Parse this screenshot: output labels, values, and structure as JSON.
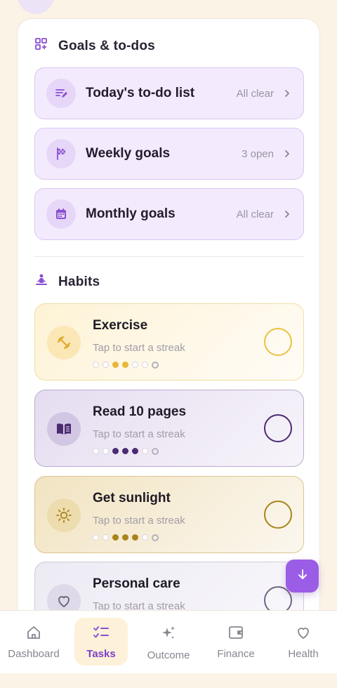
{
  "goals_section": {
    "title": "Goals & to-dos",
    "icon": "grid-plus-icon",
    "items": [
      {
        "label": "Today's to-do list",
        "status": "All clear",
        "icon": "list-edit-icon"
      },
      {
        "label": "Weekly goals",
        "status": "3 open",
        "icon": "flag-checkered-icon"
      },
      {
        "label": "Monthly goals",
        "status": "All clear",
        "icon": "calendar-icon"
      }
    ]
  },
  "habits_section": {
    "title": "Habits",
    "icon": "meditation-icon",
    "items": [
      {
        "title": "Exercise",
        "subtitle": "Tap to start a streak",
        "icon": "dumbbell-icon",
        "color": "#E8B73A",
        "streak_filled": [
          2,
          3
        ]
      },
      {
        "title": "Read 10 pages",
        "subtitle": "Tap to start a streak",
        "icon": "book-open-icon",
        "color": "#4B2A72",
        "streak_filled": [
          2,
          3,
          4
        ]
      },
      {
        "title": "Get sunlight",
        "subtitle": "Tap to start a streak",
        "icon": "sun-icon",
        "color": "#A8841B",
        "streak_filled": [
          2,
          3,
          4
        ]
      },
      {
        "title": "Personal care",
        "subtitle": "Tap to start a streak",
        "icon": "heart-icon",
        "color": "#6E6680",
        "streak_filled": []
      }
    ]
  },
  "fab": {
    "icon": "arrow-down-icon"
  },
  "nav": {
    "items": [
      {
        "label": "Dashboard",
        "icon": "home-icon",
        "active": false
      },
      {
        "label": "Tasks",
        "icon": "checklist-icon",
        "active": true
      },
      {
        "label": "Outcome",
        "icon": "sparkles-icon",
        "active": false
      },
      {
        "label": "Finance",
        "icon": "wallet-icon",
        "active": false
      },
      {
        "label": "Health",
        "icon": "heart-icon",
        "active": false
      }
    ]
  },
  "colors": {
    "accent": "#9B5DE5",
    "background": "#FBF3E6",
    "goal_row_bg": "#F3EBFD"
  }
}
